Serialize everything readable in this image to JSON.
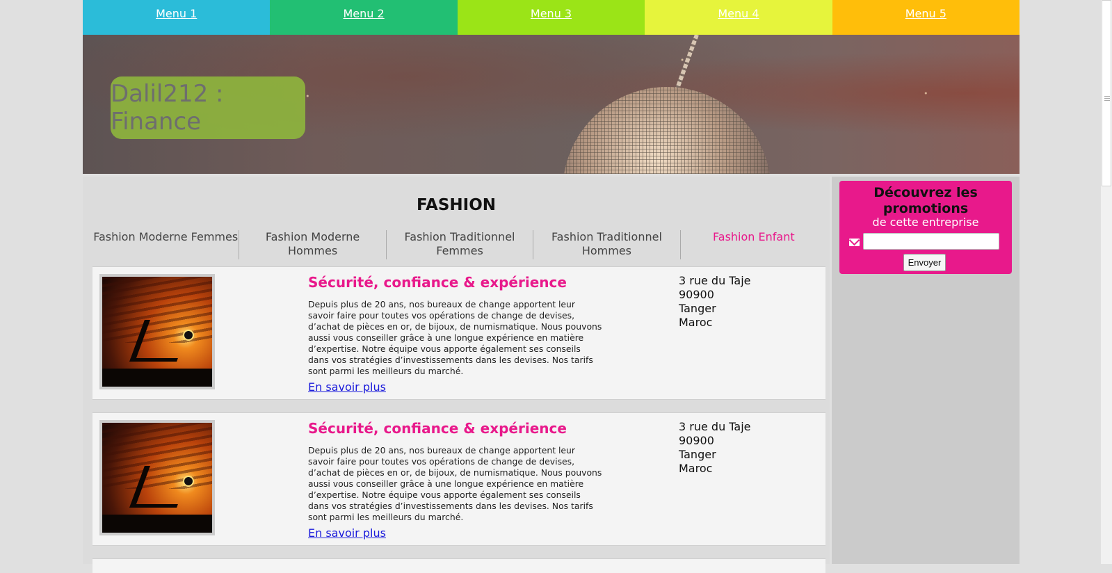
{
  "nav": {
    "items": [
      {
        "label": "Menu 1",
        "color": "#2bbcd9"
      },
      {
        "label": "Menu 2",
        "color": "#22bf73"
      },
      {
        "label": "Menu 3",
        "color": "#9be417"
      },
      {
        "label": "Menu 4",
        "color": "#e6f43c"
      },
      {
        "label": "Menu 5",
        "color": "#ffbe0a"
      }
    ]
  },
  "banner": {
    "site_title": "Dalil212 : Finance"
  },
  "main": {
    "section_title": "FASHION",
    "tabs": [
      {
        "label": "Fashion Moderne Femmes",
        "active": false
      },
      {
        "label": "Fashion Moderne Hommes",
        "active": false
      },
      {
        "label": "Fashion Traditionnel Femmes",
        "active": false
      },
      {
        "label": "Fashion Traditionnel Hommes",
        "active": false
      },
      {
        "label": "Fashion Enfant",
        "active": true
      }
    ],
    "listings": [
      {
        "title": "Sécurité, confiance & expérience",
        "description": "Depuis plus de 20 ans, nos bureaux de change apportent leur savoir faire pour toutes vos opérations de change de devises, d’achat de pièces en or, de bijoux, de numismatique. Nous pouvons aussi vous conseiller grâce à une longue expérience en matière d’expertise. Notre équipe vous apporte également ses conseils dans vos stratégies d’investissements dans les devises. Nos tarifs sont parmi les meilleurs du marché.",
        "link": "En savoir plus",
        "address": {
          "street": "3 rue du Taje",
          "postal": "90900",
          "city": "Tanger",
          "country": "Maroc"
        }
      },
      {
        "title": "Sécurité, confiance & expérience",
        "description": "Depuis plus de 20 ans, nos bureaux de change apportent leur savoir faire pour toutes vos opérations de change de devises, d’achat de pièces en or, de bijoux, de numismatique. Nous pouvons aussi vous conseiller grâce à une longue expérience en matière d’expertise. Notre équipe vous apporte également ses conseils dans vos stratégies d’investissements dans les devises. Nos tarifs sont parmi les meilleurs du marché.",
        "link": "En savoir plus",
        "address": {
          "street": "3 rue du Taje",
          "postal": "90900",
          "city": "Tanger",
          "country": "Maroc"
        }
      }
    ]
  },
  "sidebar": {
    "promo": {
      "heading": "Découvrez les promotions",
      "subheading": "de cette entreprise",
      "email_value": "",
      "submit_label": "Envoyer",
      "icon": "envelope-icon",
      "color": "#e8198b"
    }
  },
  "colors": {
    "accent": "#e8198b",
    "link": "#1a1adb",
    "page_bg": "#e0e0e0"
  }
}
